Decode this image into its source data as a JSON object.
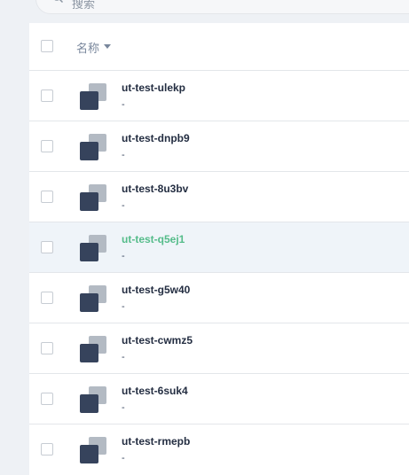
{
  "search": {
    "placeholder": "搜索"
  },
  "table": {
    "header": {
      "name_label": "名称"
    },
    "rows": [
      {
        "name": "ut-test-ulekp",
        "description": "-"
      },
      {
        "name": "ut-test-dnpb9",
        "description": "-"
      },
      {
        "name": "ut-test-8u3bv",
        "description": "-"
      },
      {
        "name": "ut-test-q5ej1",
        "description": "-"
      },
      {
        "name": "ut-test-g5w40",
        "description": "-"
      },
      {
        "name": "ut-test-cwmz5",
        "description": "-"
      },
      {
        "name": "ut-test-6suk4",
        "description": "-"
      },
      {
        "name": "ut-test-rmepb",
        "description": "-"
      }
    ]
  },
  "colors": {
    "accent": "#55bc8a",
    "text": "#242e42",
    "icon_dark": "#36435c",
    "icon_light": "#b3bac3"
  }
}
